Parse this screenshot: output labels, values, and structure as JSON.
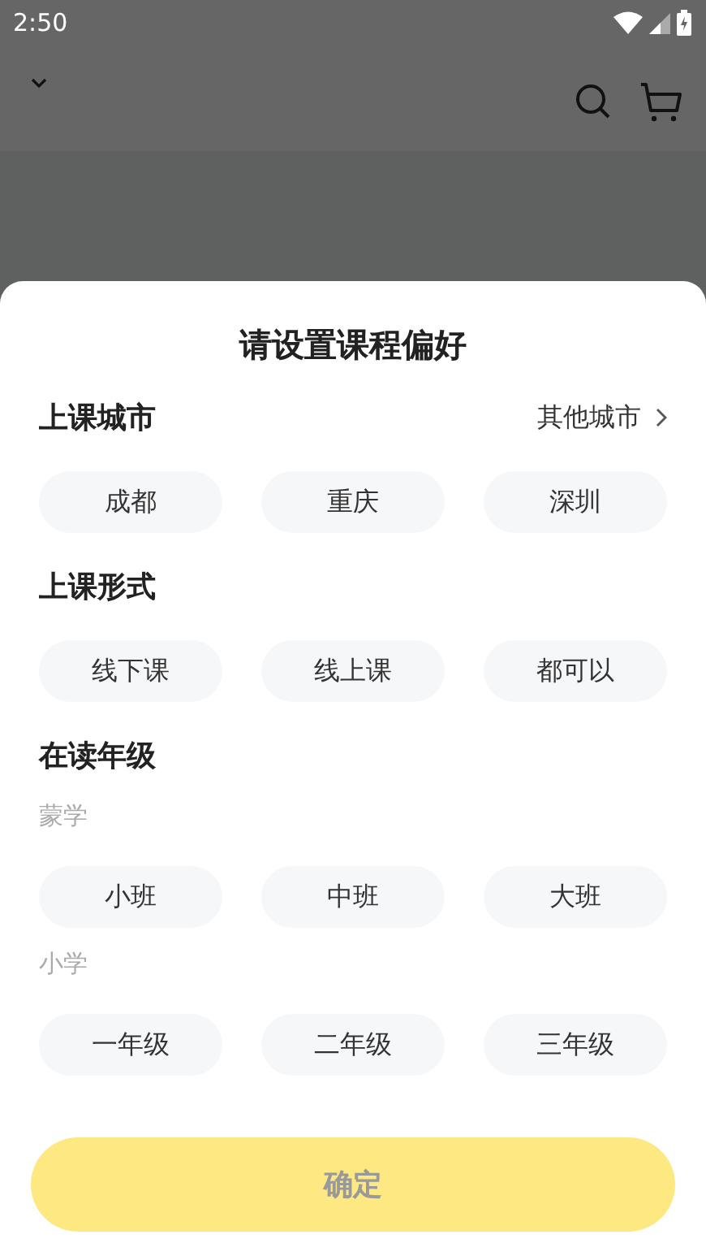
{
  "status_bar": {
    "time": "2:50"
  },
  "sheet": {
    "title": "请设置课程偏好",
    "sections": [
      {
        "title": "上课城市",
        "link": "其他城市",
        "groups": [
          {
            "chips": [
              {
                "label": "成都",
                "selected": false
              },
              {
                "label": "重庆",
                "selected": false
              },
              {
                "label": "深圳",
                "selected": false
              }
            ]
          }
        ]
      },
      {
        "title": "上课形式",
        "groups": [
          {
            "chips": [
              {
                "label": "线下课",
                "selected": false
              },
              {
                "label": "线上课",
                "selected": false
              },
              {
                "label": "都可以",
                "selected": false
              }
            ]
          }
        ]
      },
      {
        "title": "在读年级",
        "groups": [
          {
            "label": "蒙学",
            "chips": [
              {
                "label": "小班",
                "selected": false
              },
              {
                "label": "中班",
                "selected": false
              },
              {
                "label": "大班",
                "selected": false
              }
            ]
          },
          {
            "label": "小学",
            "chips": [
              {
                "label": "一年级",
                "selected": false
              },
              {
                "label": "二年级",
                "selected": false
              },
              {
                "label": "三年级",
                "selected": false
              }
            ]
          }
        ]
      }
    ],
    "confirm": {
      "label": "确定",
      "disabled": true
    }
  }
}
